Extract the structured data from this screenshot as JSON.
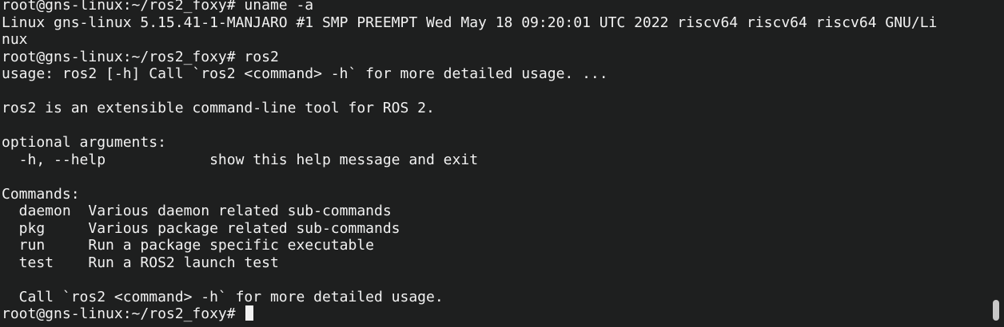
{
  "terminal": {
    "lines": [
      "root@gns-linux:~/ros2_foxy# uname -a",
      "Linux gns-linux 5.15.41-1-MANJARO #1 SMP PREEMPT Wed May 18 09:20:01 UTC 2022 riscv64 riscv64 riscv64 GNU/Li",
      "nux",
      "root@gns-linux:~/ros2_foxy# ros2",
      "usage: ros2 [-h] Call `ros2 <command> -h` for more detailed usage. ...",
      "",
      "ros2 is an extensible command-line tool for ROS 2.",
      "",
      "optional arguments:",
      "  -h, --help            show this help message and exit",
      "",
      "Commands:",
      "  daemon  Various daemon related sub-commands",
      "  pkg     Various package related sub-commands",
      "  run     Run a package specific executable",
      "  test    Run a ROS2 launch test",
      "",
      "  Call `ros2 <command> -h` for more detailed usage."
    ],
    "prompt": "root@gns-linux:~/ros2_foxy# "
  }
}
